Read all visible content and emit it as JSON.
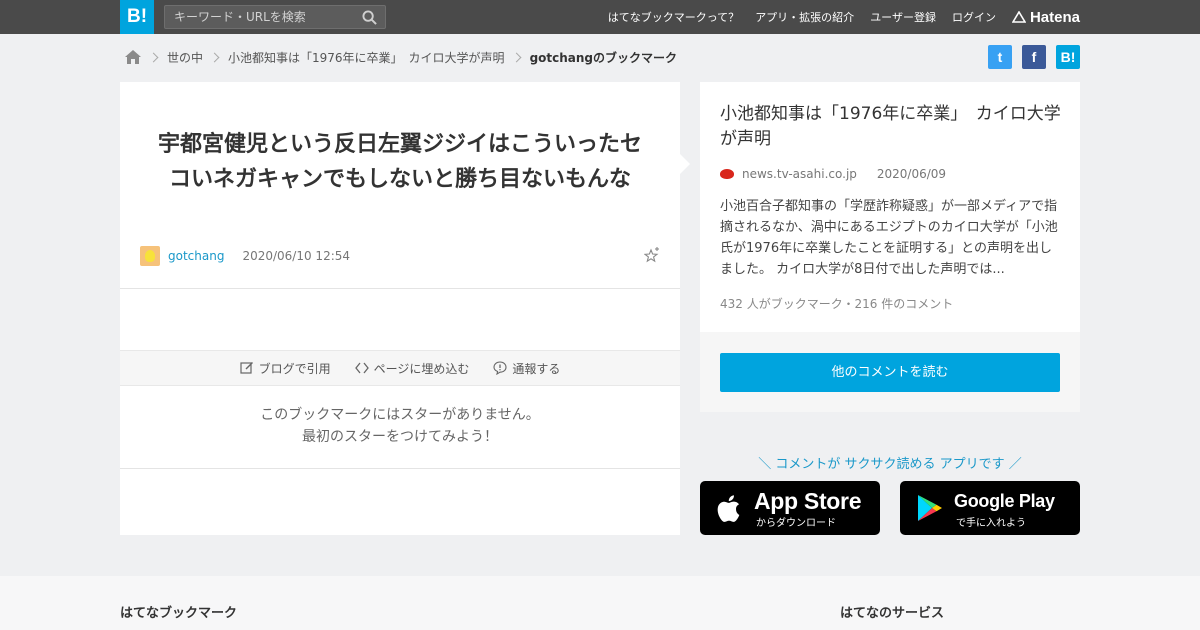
{
  "header": {
    "logo": "B!",
    "search_placeholder": "キーワード・URLを検索",
    "nav": [
      "はてなブックマークって？",
      "アプリ・拡張の紹介",
      "ユーザー登録",
      "ログイン"
    ],
    "brand": "Hatena"
  },
  "breadcrumb": {
    "items": [
      "世の中",
      "小池都知事は「1976年に卒業」　カイロ大学が声明",
      "gotchangのブックマーク"
    ]
  },
  "share": {
    "twitter": "t",
    "facebook": "f",
    "hatebu": "B!"
  },
  "bookmark": {
    "comment": "宇都宮健児という反日左翼ジジイはこういったセコいネガキャンでもしないと勝ち目ないもんな",
    "username": "gotchang",
    "timestamp": "2020/06/10 12:54",
    "actions": [
      "ブログで引用",
      "ページに埋め込む",
      "通報する"
    ],
    "no_star_line1": "このブックマークにはスターがありません。",
    "no_star_line2": "最初のスターをつけてみよう！"
  },
  "entry": {
    "title": "小池都知事は「1976年に卒業」　カイロ大学が声明",
    "domain": "news.tv-asahi.co.jp",
    "date": "2020/06/09",
    "summary": "小池百合子都知事の「学歴詐称疑惑」が一部メディアで指摘されるなか、渦中にあるエジプトのカイロ大学が「小池氏が1976年に卒業したことを証明する」との声明を出しました。 カイロ大学が8日付で出した声明では...",
    "stats": "432 人がブックマーク・216 件のコメント",
    "read_button": "他のコメントを読む"
  },
  "promo": {
    "text": "＼ コメントが サクサク読める アプリです ／",
    "appstore_name": "App Store",
    "appstore_sub": "からダウンロード",
    "googleplay_name": "Google Play",
    "googleplay_sub": "で手に入れよう"
  },
  "footer": {
    "left_heading": "はてなブックマーク",
    "right_heading": "はてなのサービス"
  },
  "colors": {
    "accent": "#00a4de",
    "topbar": "#4a4a4a",
    "link": "#1a98c9"
  }
}
